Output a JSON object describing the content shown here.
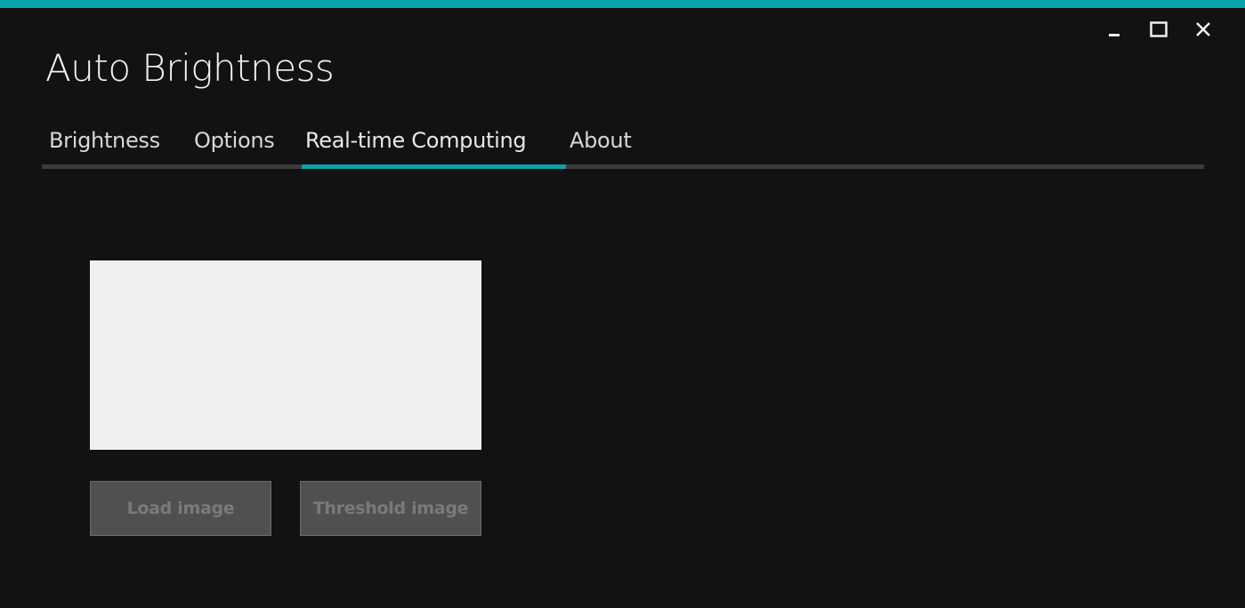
{
  "window": {
    "title": "Auto Brightness",
    "accent_color": "#0aa3a8",
    "controls": [
      {
        "name": "minimize",
        "icon": "minimize-icon"
      },
      {
        "name": "maximize",
        "icon": "maximize-icon"
      },
      {
        "name": "close",
        "icon": "close-icon"
      }
    ]
  },
  "tabs": {
    "items": [
      {
        "label": "Brightness"
      },
      {
        "label": "Options"
      },
      {
        "label": "Real-time Computing"
      },
      {
        "label": "About"
      }
    ],
    "active_index": 2
  },
  "content": {
    "load_button": "Load image",
    "threshold_button": "Threshold image",
    "buttons_enabled": false
  }
}
